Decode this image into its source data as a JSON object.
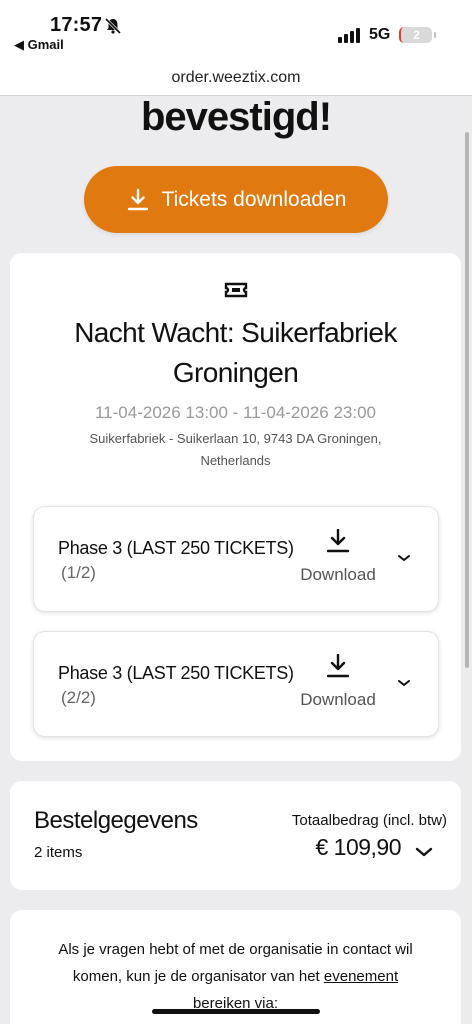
{
  "status_bar": {
    "time": "17:57",
    "back_app": "◀ Gmail",
    "network": "5G",
    "battery": "2"
  },
  "browser": {
    "url": "order.weeztix.com"
  },
  "page": {
    "heading": "bevestigd!",
    "download_all_label": "Tickets downloaden",
    "accent_color": "#e07a10"
  },
  "event": {
    "title": "Nacht Wacht: Suikerfabriek Groningen",
    "date_range": "11-04-2026 13:00 - 11-04-2026 23:00",
    "venue": "Suikerfabriek - Suikerlaan 10, 9743 DA Groningen, Netherlands",
    "tickets": [
      {
        "name": "Phase 3 (LAST 250 TICKETS)",
        "count": "(1/2)",
        "download_label": "Download"
      },
      {
        "name": "Phase 3 (LAST 250 TICKETS)",
        "count": "(2/2)",
        "download_label": "Download"
      }
    ]
  },
  "order": {
    "title": "Bestelgegevens",
    "items": "2 items",
    "total_label": "Totaalbedrag (incl. btw)",
    "total_value": "€ 109,90"
  },
  "contact": {
    "text_part1": "Als je vragen hebt of met de organisatie in contact wil komen, kun je de organisator van het ",
    "link_text": "evenement bereiken via:"
  }
}
